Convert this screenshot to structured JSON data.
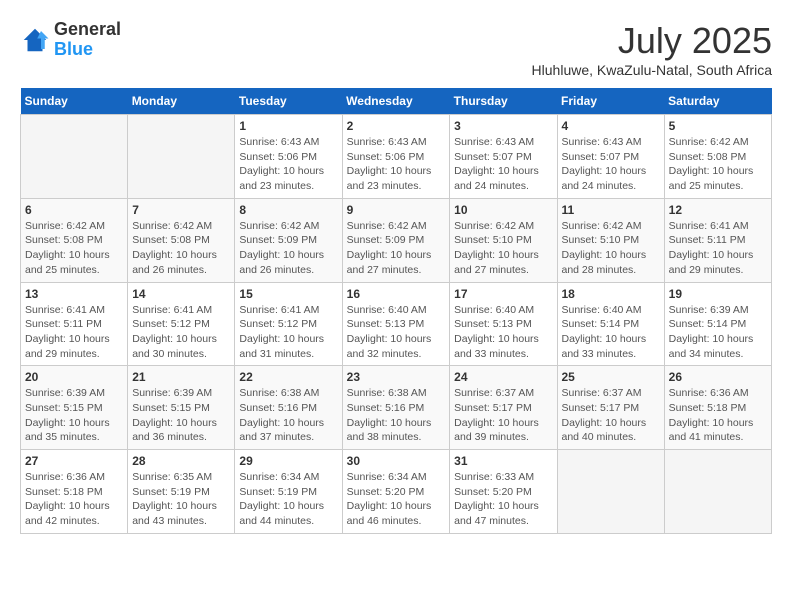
{
  "header": {
    "logo": {
      "general": "General",
      "blue": "Blue"
    },
    "title": "July 2025",
    "subtitle": "Hluhluwe, KwaZulu-Natal, South Africa"
  },
  "calendar": {
    "days_of_week": [
      "Sunday",
      "Monday",
      "Tuesday",
      "Wednesday",
      "Thursday",
      "Friday",
      "Saturday"
    ],
    "weeks": [
      [
        {
          "day": "",
          "info": ""
        },
        {
          "day": "",
          "info": ""
        },
        {
          "day": "1",
          "info": "Sunrise: 6:43 AM\nSunset: 5:06 PM\nDaylight: 10 hours and 23 minutes."
        },
        {
          "day": "2",
          "info": "Sunrise: 6:43 AM\nSunset: 5:06 PM\nDaylight: 10 hours and 23 minutes."
        },
        {
          "day": "3",
          "info": "Sunrise: 6:43 AM\nSunset: 5:07 PM\nDaylight: 10 hours and 24 minutes."
        },
        {
          "day": "4",
          "info": "Sunrise: 6:43 AM\nSunset: 5:07 PM\nDaylight: 10 hours and 24 minutes."
        },
        {
          "day": "5",
          "info": "Sunrise: 6:42 AM\nSunset: 5:08 PM\nDaylight: 10 hours and 25 minutes."
        }
      ],
      [
        {
          "day": "6",
          "info": "Sunrise: 6:42 AM\nSunset: 5:08 PM\nDaylight: 10 hours and 25 minutes."
        },
        {
          "day": "7",
          "info": "Sunrise: 6:42 AM\nSunset: 5:08 PM\nDaylight: 10 hours and 26 minutes."
        },
        {
          "day": "8",
          "info": "Sunrise: 6:42 AM\nSunset: 5:09 PM\nDaylight: 10 hours and 26 minutes."
        },
        {
          "day": "9",
          "info": "Sunrise: 6:42 AM\nSunset: 5:09 PM\nDaylight: 10 hours and 27 minutes."
        },
        {
          "day": "10",
          "info": "Sunrise: 6:42 AM\nSunset: 5:10 PM\nDaylight: 10 hours and 27 minutes."
        },
        {
          "day": "11",
          "info": "Sunrise: 6:42 AM\nSunset: 5:10 PM\nDaylight: 10 hours and 28 minutes."
        },
        {
          "day": "12",
          "info": "Sunrise: 6:41 AM\nSunset: 5:11 PM\nDaylight: 10 hours and 29 minutes."
        }
      ],
      [
        {
          "day": "13",
          "info": "Sunrise: 6:41 AM\nSunset: 5:11 PM\nDaylight: 10 hours and 29 minutes."
        },
        {
          "day": "14",
          "info": "Sunrise: 6:41 AM\nSunset: 5:12 PM\nDaylight: 10 hours and 30 minutes."
        },
        {
          "day": "15",
          "info": "Sunrise: 6:41 AM\nSunset: 5:12 PM\nDaylight: 10 hours and 31 minutes."
        },
        {
          "day": "16",
          "info": "Sunrise: 6:40 AM\nSunset: 5:13 PM\nDaylight: 10 hours and 32 minutes."
        },
        {
          "day": "17",
          "info": "Sunrise: 6:40 AM\nSunset: 5:13 PM\nDaylight: 10 hours and 33 minutes."
        },
        {
          "day": "18",
          "info": "Sunrise: 6:40 AM\nSunset: 5:14 PM\nDaylight: 10 hours and 33 minutes."
        },
        {
          "day": "19",
          "info": "Sunrise: 6:39 AM\nSunset: 5:14 PM\nDaylight: 10 hours and 34 minutes."
        }
      ],
      [
        {
          "day": "20",
          "info": "Sunrise: 6:39 AM\nSunset: 5:15 PM\nDaylight: 10 hours and 35 minutes."
        },
        {
          "day": "21",
          "info": "Sunrise: 6:39 AM\nSunset: 5:15 PM\nDaylight: 10 hours and 36 minutes."
        },
        {
          "day": "22",
          "info": "Sunrise: 6:38 AM\nSunset: 5:16 PM\nDaylight: 10 hours and 37 minutes."
        },
        {
          "day": "23",
          "info": "Sunrise: 6:38 AM\nSunset: 5:16 PM\nDaylight: 10 hours and 38 minutes."
        },
        {
          "day": "24",
          "info": "Sunrise: 6:37 AM\nSunset: 5:17 PM\nDaylight: 10 hours and 39 minutes."
        },
        {
          "day": "25",
          "info": "Sunrise: 6:37 AM\nSunset: 5:17 PM\nDaylight: 10 hours and 40 minutes."
        },
        {
          "day": "26",
          "info": "Sunrise: 6:36 AM\nSunset: 5:18 PM\nDaylight: 10 hours and 41 minutes."
        }
      ],
      [
        {
          "day": "27",
          "info": "Sunrise: 6:36 AM\nSunset: 5:18 PM\nDaylight: 10 hours and 42 minutes."
        },
        {
          "day": "28",
          "info": "Sunrise: 6:35 AM\nSunset: 5:19 PM\nDaylight: 10 hours and 43 minutes."
        },
        {
          "day": "29",
          "info": "Sunrise: 6:34 AM\nSunset: 5:19 PM\nDaylight: 10 hours and 44 minutes."
        },
        {
          "day": "30",
          "info": "Sunrise: 6:34 AM\nSunset: 5:20 PM\nDaylight: 10 hours and 46 minutes."
        },
        {
          "day": "31",
          "info": "Sunrise: 6:33 AM\nSunset: 5:20 PM\nDaylight: 10 hours and 47 minutes."
        },
        {
          "day": "",
          "info": ""
        },
        {
          "day": "",
          "info": ""
        }
      ]
    ]
  }
}
